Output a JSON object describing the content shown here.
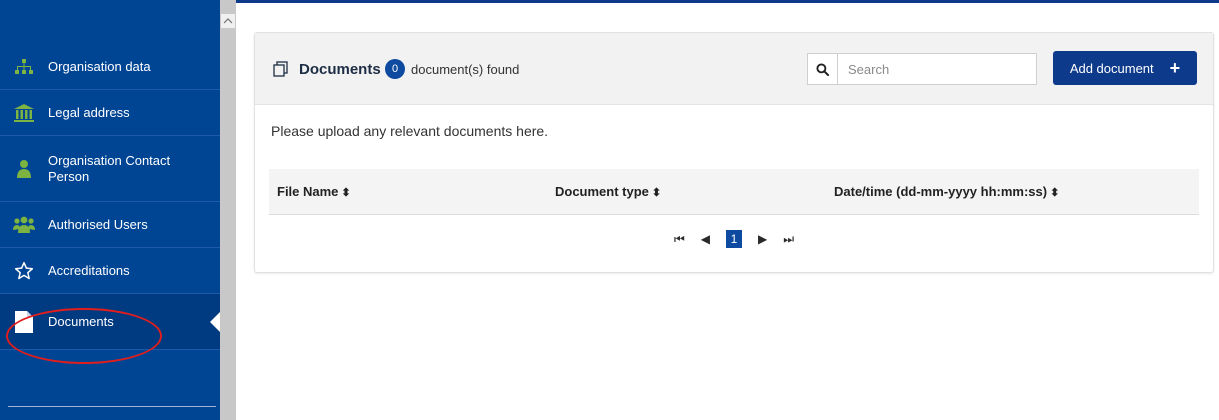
{
  "sidebar": {
    "items": [
      {
        "label": "Organisation data",
        "icon": "org-chart-icon"
      },
      {
        "label": "Legal address",
        "icon": "bank-building-icon"
      },
      {
        "label": "Organisation Contact Person",
        "icon": "person-icon"
      },
      {
        "label": "Authorised Users",
        "icon": "users-group-icon"
      },
      {
        "label": "Accreditations",
        "icon": "star-outline-icon"
      },
      {
        "label": "Documents",
        "icon": "document-icon",
        "active": true
      }
    ]
  },
  "panel": {
    "title": "Documents",
    "count": "0",
    "found_text": "document(s) found",
    "search_placeholder": "Search",
    "add_button_label": "Add document",
    "add_button_icon": "+",
    "upload_text": "Please upload any relevant documents here."
  },
  "table": {
    "columns": [
      {
        "label": "File Name"
      },
      {
        "label": "Document type"
      },
      {
        "label": "Date/time (dd-mm-yyyy hh:mm:ss)"
      }
    ],
    "sort_glyph": "⬍"
  },
  "pagination": {
    "first": "⏮",
    "prev": "◀",
    "current_page": "1",
    "next": "▶",
    "last": "⏭"
  },
  "colors": {
    "sidebar": "#004494",
    "accent": "#0d3a8a",
    "icon_green": "#7cb342",
    "highlight": "#e01e1e"
  }
}
